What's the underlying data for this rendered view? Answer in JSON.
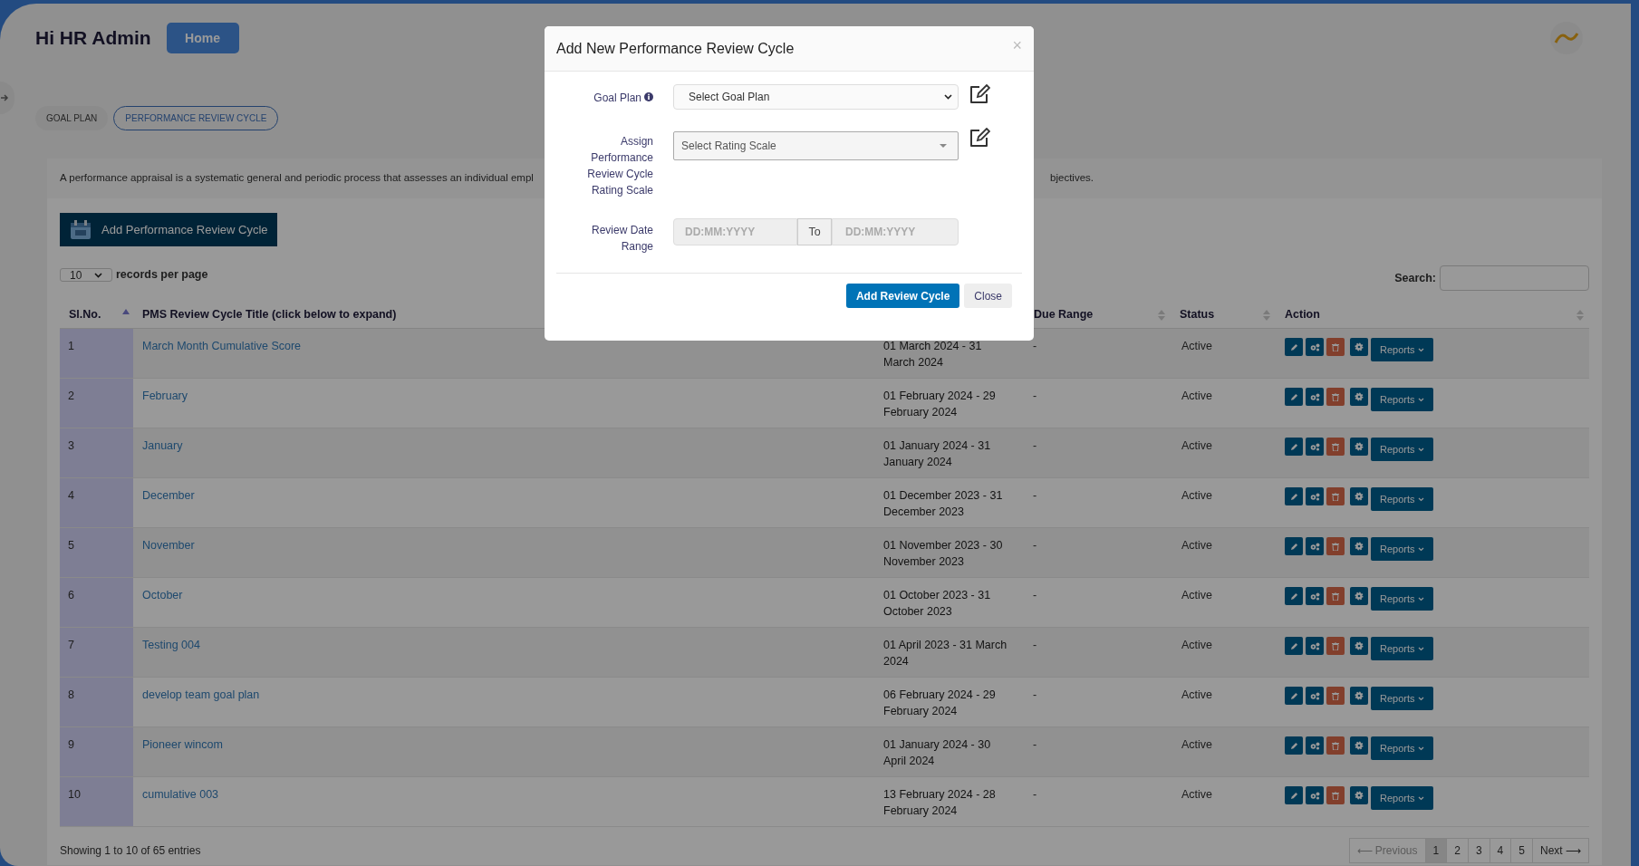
{
  "header": {
    "greeting": "Hi HR Admin",
    "home_button": "Home"
  },
  "tabs": [
    {
      "label": "GOAL PLAN",
      "selected": false
    },
    {
      "label": "PERFORMANCE REVIEW CYCLE",
      "selected": true
    }
  ],
  "description": {
    "text_start": "A performance appraisal is a systematic general and periodic process that assesses an individual empl",
    "text_end": "bjectives."
  },
  "add_button": "Add Performance Review Cycle",
  "page_length": {
    "value": "10",
    "label": "records per page"
  },
  "search": {
    "label": "Search:"
  },
  "table": {
    "columns": [
      {
        "label": "Sl.No.",
        "sorted_ascending": true
      },
      {
        "label": "PMS Review Cycle Title (click below to expand)"
      },
      {
        "label": "Due Range",
        "sorted_ascending": false
      },
      {
        "label": "Status",
        "sorted_ascending": false
      },
      {
        "label": "Action",
        "sorted_ascending": false
      }
    ],
    "rows": [
      {
        "sl": "1",
        "title": "March Month Cumulative Score",
        "date_range": "01 March 2024 - 31 March 2024",
        "due_range": "-",
        "status": "Active",
        "reports": "Reports"
      },
      {
        "sl": "2",
        "title": "February",
        "date_range": "01 February 2024 - 29 February 2024",
        "due_range": "-",
        "status": "Active",
        "reports": "Reports"
      },
      {
        "sl": "3",
        "title": "January",
        "date_range": "01 January 2024 - 31 January 2024",
        "due_range": "-",
        "status": "Active",
        "reports": "Reports"
      },
      {
        "sl": "4",
        "title": "December",
        "date_range": "01 December 2023 - 31 December 2023",
        "due_range": "-",
        "status": "Active",
        "reports": "Reports"
      },
      {
        "sl": "5",
        "title": "November",
        "date_range": "01 November 2023 - 30 November 2023",
        "due_range": "-",
        "status": "Active",
        "reports": "Reports"
      },
      {
        "sl": "6",
        "title": "October",
        "date_range": "01 October 2023 - 31 October 2023",
        "due_range": "-",
        "status": "Active",
        "reports": "Reports"
      },
      {
        "sl": "7",
        "title": "Testing 004",
        "date_range": "01 April 2023 - 31 March 2024",
        "due_range": "-",
        "status": "Active",
        "reports": "Reports"
      },
      {
        "sl": "8",
        "title": "develop team goal plan",
        "date_range": "06 February 2024 - 29 February 2024",
        "due_range": "-",
        "status": "Active",
        "reports": "Reports"
      },
      {
        "sl": "9",
        "title": "Pioneer wincom",
        "date_range": "01 January 2024 - 30 April 2024",
        "due_range": "-",
        "status": "Active",
        "reports": "Reports"
      },
      {
        "sl": "10",
        "title": "cumulative 003",
        "date_range": "13 February 2024 - 28 February 2024",
        "due_range": "-",
        "status": "Active",
        "reports": "Reports"
      }
    ]
  },
  "info": "Showing 1 to 10 of 65 entries",
  "pagination": [
    {
      "label": "⟵ Previous",
      "selected": false,
      "disabled": true
    },
    {
      "label": "1",
      "selected": true,
      "disabled": false
    },
    {
      "label": "2",
      "selected": false,
      "disabled": false
    },
    {
      "label": "3",
      "selected": false,
      "disabled": false
    },
    {
      "label": "4",
      "selected": false,
      "disabled": false
    },
    {
      "label": "5",
      "selected": false,
      "disabled": false
    },
    {
      "label": "Next ⟶",
      "selected": false,
      "disabled": false
    }
  ],
  "modal": {
    "title": "Add New Performance Review Cycle",
    "close": "×",
    "fields": [
      {
        "kind": "select",
        "label": "Goal Plan",
        "info": true,
        "edit_icon": true,
        "placeholder": "Select Goal Plan"
      },
      {
        "kind": "combo",
        "label": "Assign Performance Review Cycle Rating Scale",
        "info": false,
        "edit_icon": true,
        "placeholder": "Select Rating Scale"
      },
      {
        "kind": "daterange",
        "label": "Review Date Range",
        "info": false,
        "edit_icon": false,
        "from_placeholder": "DD:MM:YYYY",
        "separator": "To",
        "to_placeholder": "DD:MM:YYYY"
      }
    ],
    "buttons": [
      {
        "label": "Add Review Cycle",
        "kind": "primary"
      },
      {
        "label": "Close",
        "kind": "secondary"
      }
    ]
  }
}
